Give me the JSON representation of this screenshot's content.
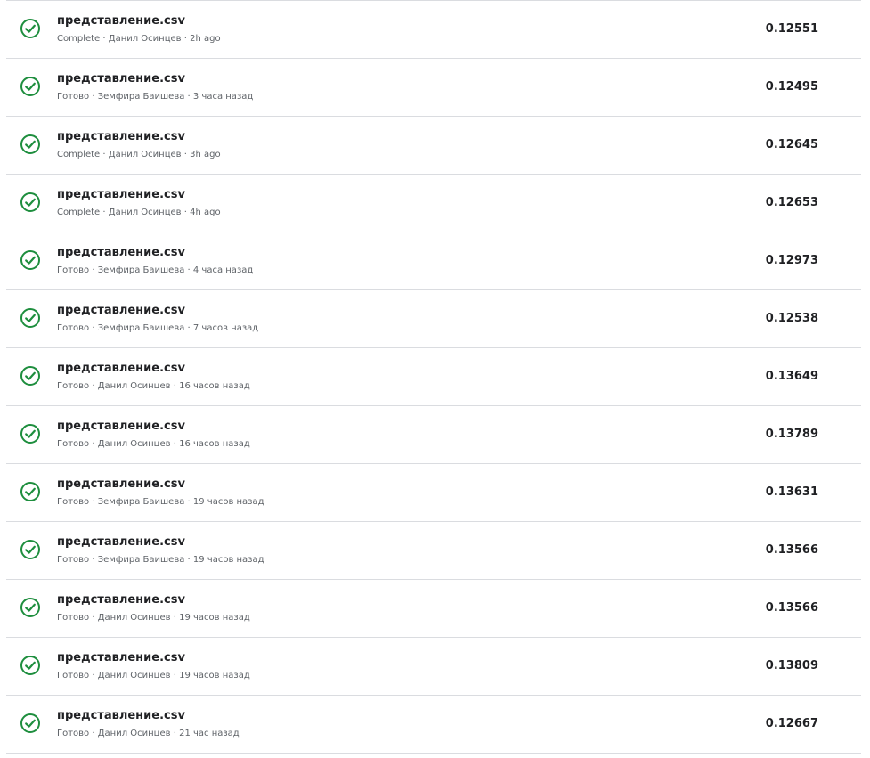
{
  "colors": {
    "success": "#1e8e3e",
    "divider": "#dadce0",
    "primary_text": "#202124",
    "secondary_text": "#5f6368"
  },
  "submissions": [
    {
      "file": "представление.csv",
      "status": "Complete",
      "author": "Данил Осинцев",
      "time": "2h ago",
      "score": "0.12551",
      "icon": "check-circle-icon"
    },
    {
      "file": "представление.csv",
      "status": "Готово",
      "author": "Земфира Баишева",
      "time": "3 часа назад",
      "score": "0.12495",
      "icon": "check-circle-icon"
    },
    {
      "file": "представление.csv",
      "status": "Complete",
      "author": "Данил Осинцев",
      "time": "3h ago",
      "score": "0.12645",
      "icon": "check-circle-icon"
    },
    {
      "file": "представление.csv",
      "status": "Complete",
      "author": "Данил Осинцев",
      "time": "4h ago",
      "score": "0.12653",
      "icon": "check-circle-icon"
    },
    {
      "file": "представление.csv",
      "status": "Готово",
      "author": "Земфира Баишева",
      "time": "4 часа назад",
      "score": "0.12973",
      "icon": "check-circle-icon"
    },
    {
      "file": "представление.csv",
      "status": "Готово",
      "author": "Земфира Баишева",
      "time": "7 часов назад",
      "score": "0.12538",
      "icon": "check-circle-icon"
    },
    {
      "file": "представление.csv",
      "status": "Готово",
      "author": "Данил Осинцев",
      "time": "16 часов назад",
      "score": "0.13649",
      "icon": "check-circle-icon"
    },
    {
      "file": "представление.csv",
      "status": "Готово",
      "author": "Данил Осинцев",
      "time": "16 часов назад",
      "score": "0.13789",
      "icon": "check-circle-icon"
    },
    {
      "file": "представление.csv",
      "status": "Готово",
      "author": "Земфира Баишева",
      "time": "19 часов назад",
      "score": "0.13631",
      "icon": "check-circle-icon"
    },
    {
      "file": "представление.csv",
      "status": "Готово",
      "author": "Земфира Баишева",
      "time": "19 часов назад",
      "score": "0.13566",
      "icon": "check-circle-icon"
    },
    {
      "file": "представление.csv",
      "status": "Готово",
      "author": "Данил Осинцев",
      "time": "19 часов назад",
      "score": "0.13566",
      "icon": "check-circle-icon"
    },
    {
      "file": "представление.csv",
      "status": "Готово",
      "author": "Данил Осинцев",
      "time": "19 часов назад",
      "score": "0.13809",
      "icon": "check-circle-icon"
    },
    {
      "file": "представление.csv",
      "status": "Готово",
      "author": "Данил Осинцев",
      "time": "21 час назад",
      "score": "0.12667",
      "icon": "check-circle-icon"
    }
  ]
}
